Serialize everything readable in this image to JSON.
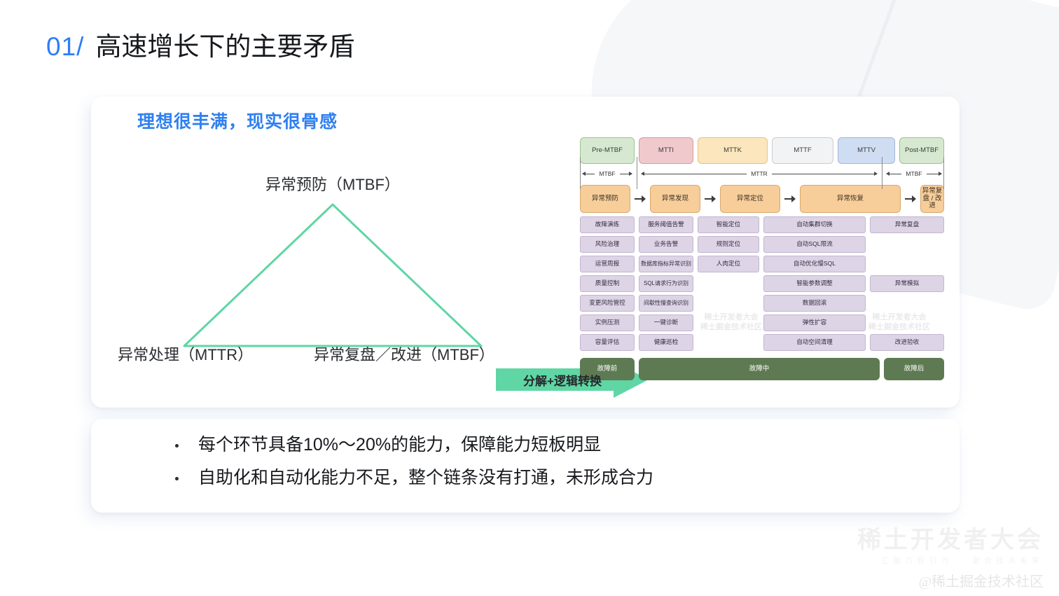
{
  "slide": {
    "number": "01/",
    "title": "高速增长下的主要矛盾"
  },
  "left_panel": {
    "subtitle": "理想很丰满，现实很骨感",
    "triangle": {
      "top_label": "异常预防（MTBF）",
      "left_label": "异常处理（MTTR）",
      "right_label": "异常复盘／改进（MTBF）",
      "stroke_color": "#5fd6a4"
    },
    "transform_arrow": {
      "label": "分解+逻辑转换",
      "color": "#5fd6a4"
    }
  },
  "flow_diagram": {
    "phases": [
      {
        "label": "Pre-MTBF",
        "color": "#d6e9d0",
        "border": "#9cc192"
      },
      {
        "label": "MTTI",
        "color": "#f0c9cd",
        "border": "#d79aa1"
      },
      {
        "label": "MTTK",
        "color": "#fbe6bd",
        "border": "#e0c489"
      },
      {
        "label": "MTTF",
        "color": "#f2f3f5",
        "border": "#c9ccd1"
      },
      {
        "label": "MTTV",
        "color": "#cfddf2",
        "border": "#9fb6d9"
      },
      {
        "label": "Post-MTBF",
        "color": "#d6e9d0",
        "border": "#9cc192"
      }
    ],
    "metrics": [
      "MTBF",
      "MTTR",
      "MTBF"
    ],
    "stages": [
      "异常预防",
      "异常发现",
      "异常定位",
      "异常恢复",
      "异常复盘 / 改进"
    ],
    "capability_columns": [
      [
        "故障演练",
        "风险治理",
        "运营周报",
        "质量控制",
        "变更风险管控",
        "实例压测",
        "容量评估"
      ],
      [
        "服务阈值告警",
        "业务告警",
        "数据库指标异常识别",
        "SQL请求行为识别",
        "间歇性慢查询识别",
        "一键诊断",
        "健康巡检"
      ],
      [
        "智能定位",
        "规则定位",
        "人肉定位"
      ],
      [
        "自动集群切换",
        "自动SQL限流",
        "自动优化慢SQL",
        "智能参数调整",
        "数据回滚",
        "弹性扩容",
        "自动空间清理"
      ],
      [
        "异常复盘",
        "",
        "",
        "异常模拟",
        "",
        "",
        "改进验收"
      ]
    ],
    "phase_bars": [
      "故障前",
      "故障中",
      "故障后"
    ],
    "inner_watermark": "稀土开发者大会\n稀土掘金技术社区",
    "stage_box_color": "#f7cd9a",
    "capability_box_color": "#ddd4e6",
    "phase_bar_color": "#5e7a52"
  },
  "bullets": [
    "每个环节具备10%～20%的能力，保障能力短板明显",
    "自助化和自动化能力不足，整个链条没有打通，未形成合力"
  ],
  "watermark": {
    "main": "稀土开发者大会",
    "sub": "汇聚万有引力 · 聚合技术未来",
    "handle": "@稀土掘金技术社区"
  },
  "colors": {
    "accent_blue": "#2e7df6",
    "subtitle_blue": "#2f80f0",
    "mint": "#5fd6a4",
    "text_dark": "#17191d"
  }
}
